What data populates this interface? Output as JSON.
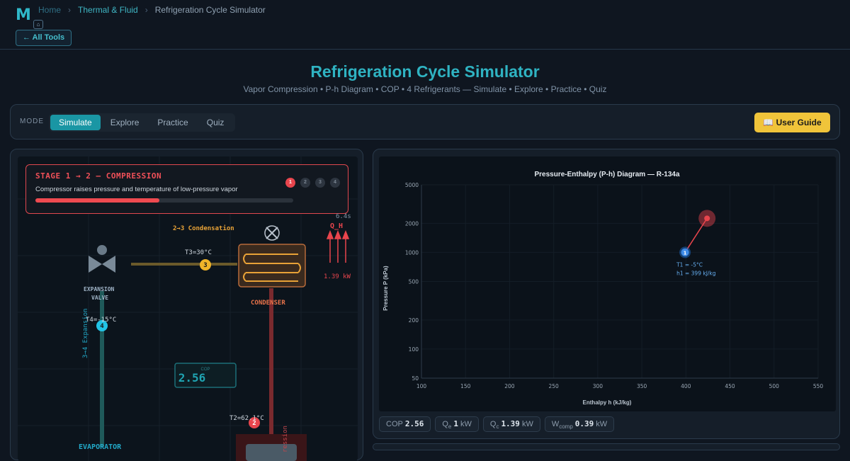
{
  "breadcrumb": {
    "home": "Home",
    "category": "Thermal & Fluid",
    "current": "Refrigeration Cycle Simulator"
  },
  "nav": {
    "all_tools": "← All Tools"
  },
  "header": {
    "title": "Refrigeration Cycle Simulator",
    "subtitle": "Vapor Compression • P-h Diagram • COP • 4 Refrigerants — Simulate • Explore • Practice • Quiz"
  },
  "mode": {
    "label": "MODE",
    "tabs": [
      "Simulate",
      "Explore",
      "Practice",
      "Quiz"
    ],
    "active": "Simulate",
    "user_guide": "📖 User Guide"
  },
  "stage": {
    "title": "STAGE 1 → 2 — COMPRESSION",
    "description": "Compressor raises pressure and temperature of low-pressure vapor",
    "progress": 0.48,
    "steps": [
      "1",
      "2",
      "3",
      "4"
    ],
    "active_step": 1,
    "timer": "6.4s"
  },
  "cycle": {
    "condensation_label": "2→3 Condensation",
    "expansion_label": "3→4 Expansion",
    "compression_label": "ression",
    "qh_label": "Q_H",
    "qh_value": "1.39 kW",
    "condenser": "CONDENSER",
    "expansion_valve_line1": "EXPANSION",
    "expansion_valve_line2": "VALVE",
    "evaporator": "EVAPORATOR",
    "cop_caption": "COP",
    "cop_value": "2.56",
    "t3": "T3=30°C",
    "t4": "T4=-15°C",
    "t2": "T2=62.1°C",
    "points": [
      "1",
      "2",
      "3",
      "4"
    ]
  },
  "chart_data": {
    "type": "scatter",
    "title": "Pressure-Enthalpy (P-h) Diagram — R-134a",
    "xlabel": "Enthalpy h (kJ/kg)",
    "ylabel": "Pressure P (kPa)",
    "xlim": [
      100,
      550
    ],
    "ylim": [
      50,
      5000
    ],
    "y_scale": "log",
    "x_ticks": [
      "100",
      "150",
      "200",
      "250",
      "300",
      "350",
      "400",
      "450",
      "500",
      "550"
    ],
    "y_ticks": [
      "50",
      "100",
      "200",
      "500",
      "1000",
      "2000",
      "5000"
    ],
    "grid": true,
    "points": [
      {
        "label": "1",
        "h": 399,
        "P": 1000,
        "annotation_1": "T1 = -5°C",
        "annotation_2": "h1 = 399 kJ/kg"
      },
      {
        "label": "",
        "h": 424,
        "P": 2250
      }
    ]
  },
  "metrics": [
    {
      "label": "COP",
      "value": "2.56",
      "unit": ""
    },
    {
      "label": "Q",
      "sub": "e",
      "value": "1",
      "unit": "kW"
    },
    {
      "label": "Q",
      "sub": "c",
      "value": "1.39",
      "unit": "kW"
    },
    {
      "label": "W",
      "sub": "comp",
      "value": "0.39",
      "unit": "kW"
    }
  ],
  "colors": {
    "accent": "#1a96a4",
    "title": "#2fb3c2",
    "compression": "#e8454d",
    "condensation": "#f0b429",
    "expansion": "#22c3e6",
    "guide": "#f0c43a"
  }
}
